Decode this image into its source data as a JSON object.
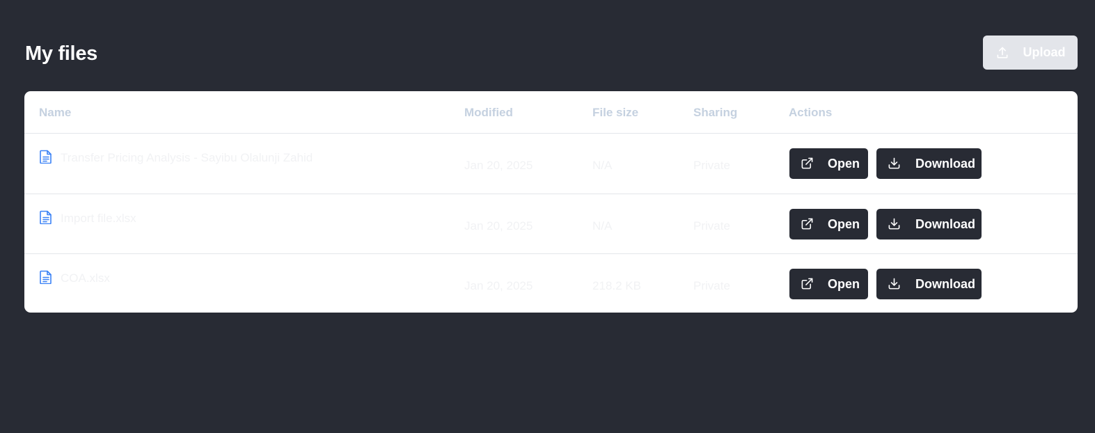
{
  "header": {
    "title": "My files",
    "upload_label": "Upload"
  },
  "table": {
    "columns": [
      "Name",
      "Modified",
      "File size",
      "Sharing",
      "Actions"
    ],
    "rows": [
      {
        "name": "Transfer Pricing Analysis - Sayibu Olalunji Zahid",
        "modified": "Jan 20, 2025",
        "size": "N/A",
        "sharing": "Private"
      },
      {
        "name": "Import file.xlsx",
        "modified": "Jan 20, 2025",
        "size": "N/A",
        "sharing": "Private"
      },
      {
        "name": "COA.xlsx",
        "modified": "Jan 20, 2025",
        "size": "218.2 KB",
        "sharing": "Private"
      }
    ],
    "open_label": "Open",
    "download_label": "Download"
  },
  "colors": {
    "background": "#282b34",
    "card": "#ffffff",
    "button": "#282b34",
    "upload_disabled": "#e3e5ea",
    "file_icon": "#3b82f6",
    "header_text": "#c5d1e0"
  },
  "icons": {
    "upload": "upload-icon",
    "file": "file-text-icon",
    "open": "external-link-icon",
    "download": "download-icon"
  }
}
